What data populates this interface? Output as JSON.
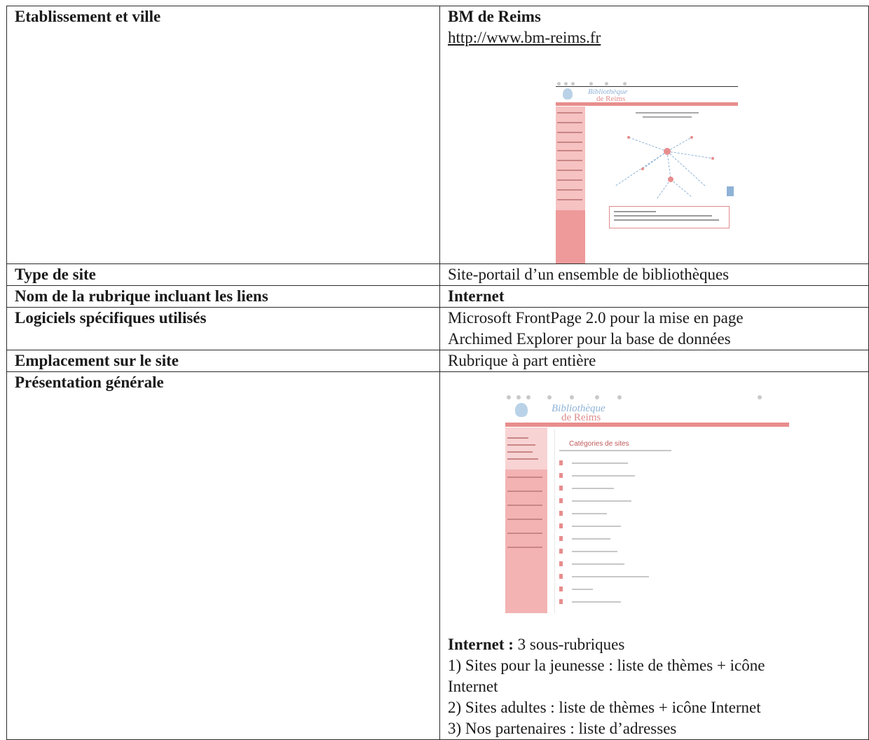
{
  "table": {
    "row1": {
      "label": "Etablissement et ville",
      "name": "BM de Reims",
      "url": "http://www.bm-reims.fr"
    },
    "row2": {
      "label": "Type de site",
      "value": "Site-portail d’un ensemble de bibliothèques"
    },
    "row3": {
      "label": "Nom de la rubrique incluant les liens",
      "value": "Internet"
    },
    "row4": {
      "label": "Logiciels spécifiques utilisés",
      "value_line1": "Microsoft FrontPage 2.0 pour la mise en page",
      "value_line2": "Archimed Explorer pour la base de données"
    },
    "row5": {
      "label": "Emplacement sur le site",
      "value": "Rubrique à part entière"
    },
    "row6": {
      "label": "Présentation générale",
      "intro_bold": "Internet :",
      "intro_rest": " 3 sous-rubriques",
      "item1_line1": "1) Sites pour la jeunesse : liste de thèmes + icône",
      "item1_line2": "Internet",
      "item2": "2) Sites adultes : liste de thèmes + icône Internet",
      "item3": "3) Nos partenaires : liste d’adresses"
    }
  },
  "screenshots": {
    "home": {
      "logo_line1": "Bibliothèque",
      "logo_line2": "de Reims"
    },
    "categories": {
      "logo_line1": "Bibliothèque",
      "logo_line2": "de Reims",
      "heading": "Catégories de sites"
    }
  },
  "colors": {
    "accent_pink": "#e88d8d",
    "accent_blue": "#8fb2d6",
    "border": "#2b2b2b"
  }
}
